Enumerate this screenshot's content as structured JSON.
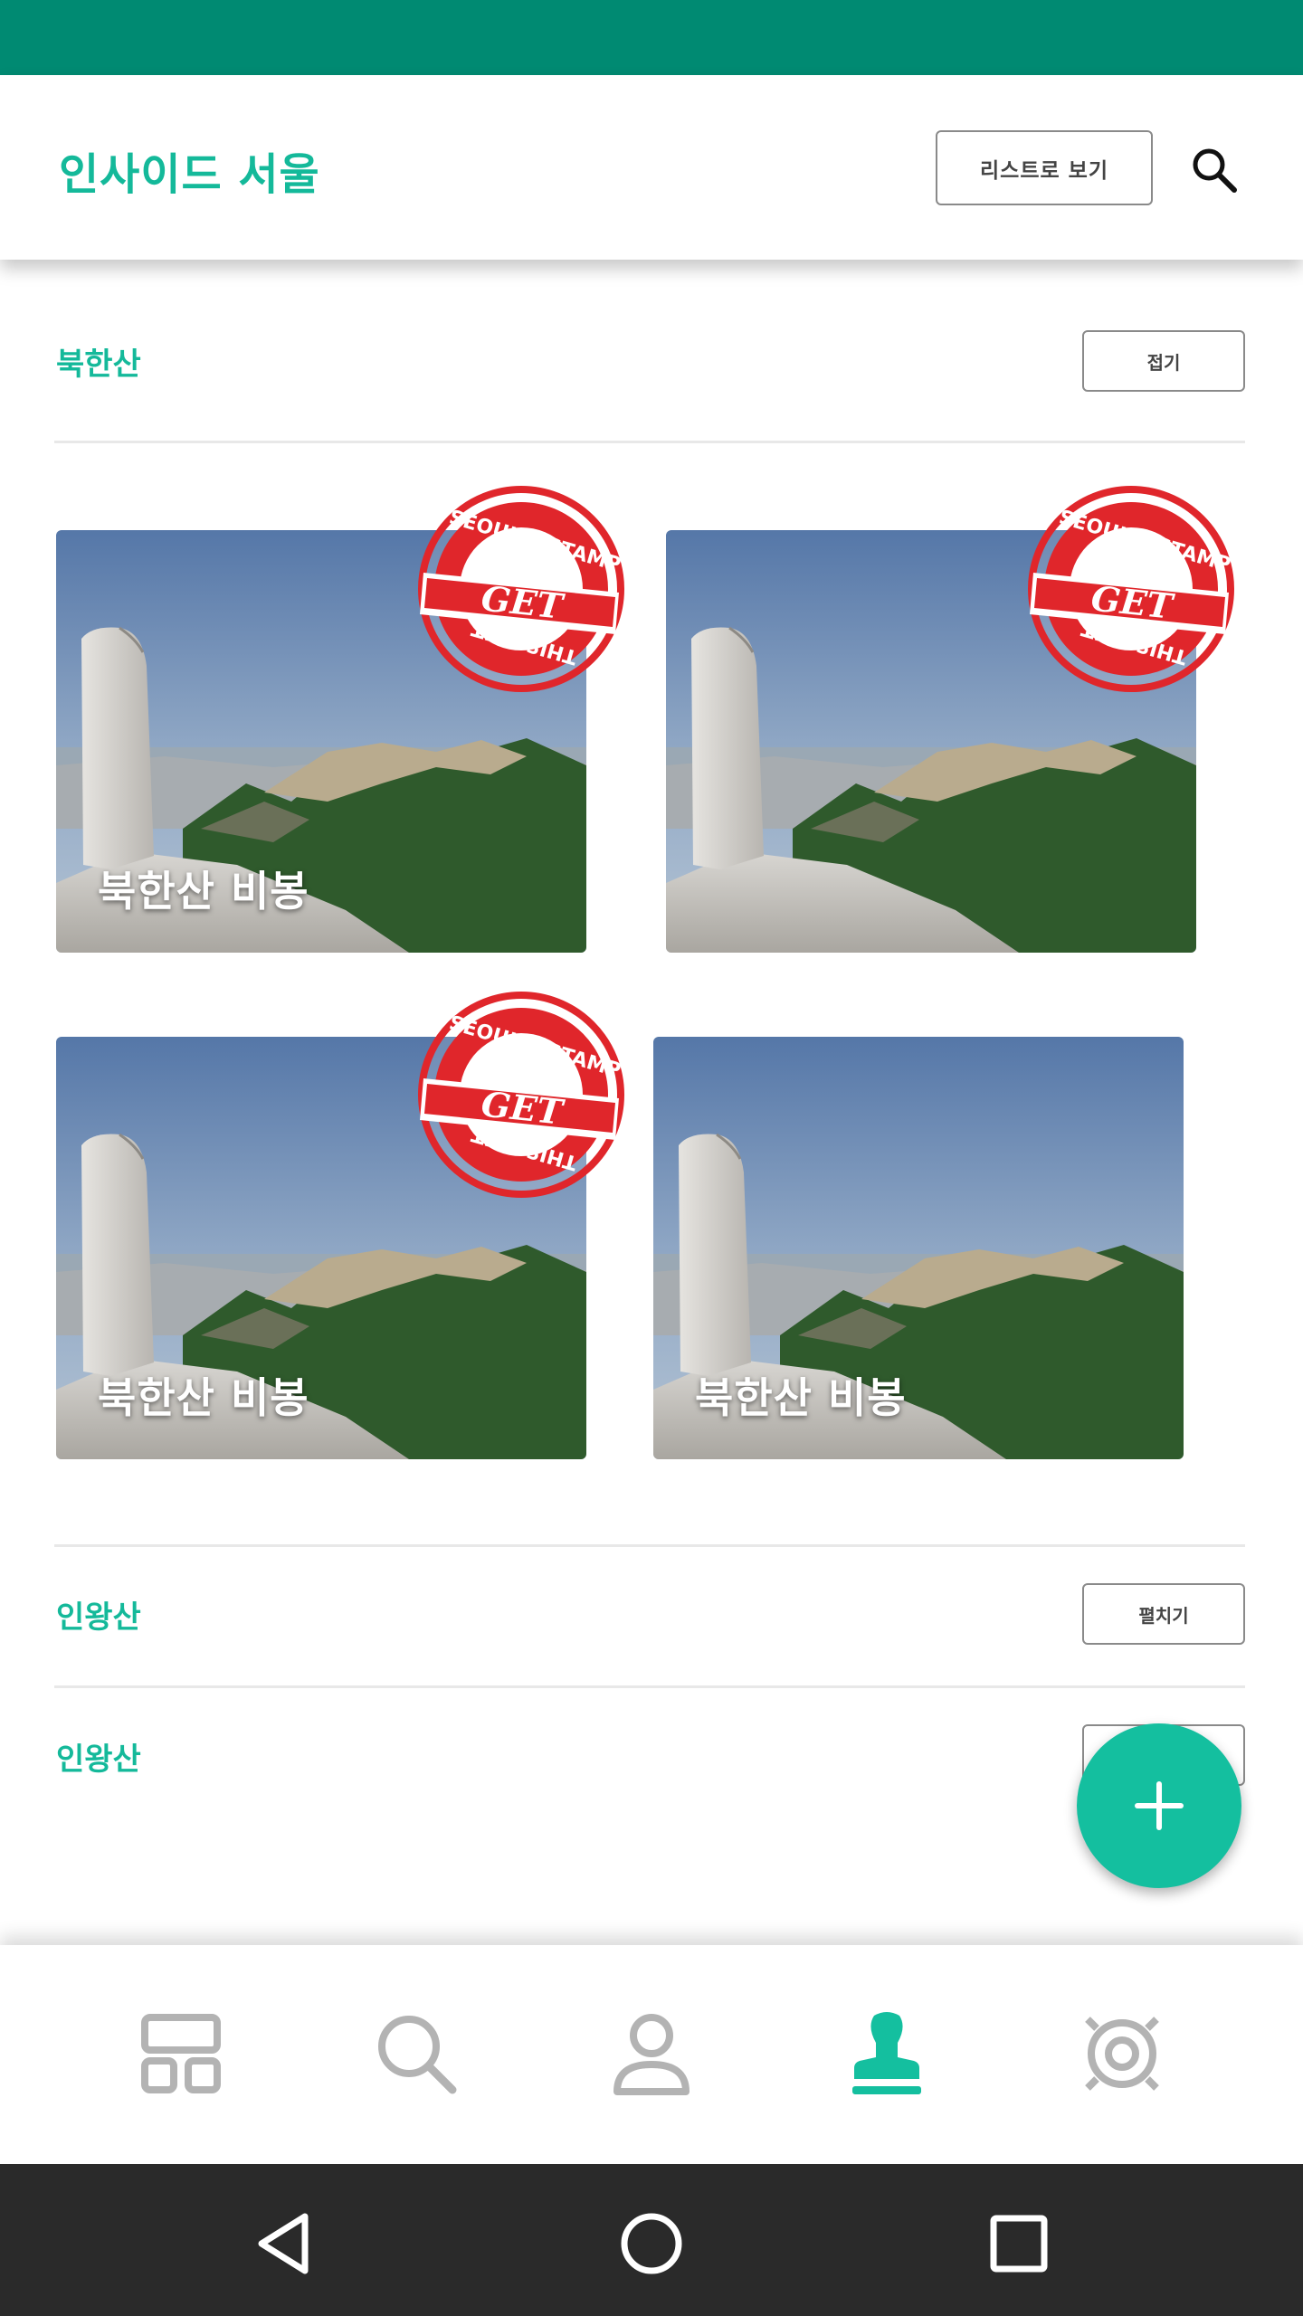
{
  "app": {
    "title": "인사이드 서울"
  },
  "header": {
    "list_view_label": "리스트로 보기",
    "search_icon": "search-icon"
  },
  "sections": [
    {
      "title": "북한산",
      "toggle_label": "접기",
      "cards": [
        {
          "label": "북한산 비봉",
          "stamped": true
        },
        {
          "label": "",
          "stamped": true
        },
        {
          "label": "북한산 비봉",
          "stamped": true
        },
        {
          "label": "북한산 비봉",
          "stamped": false
        }
      ]
    },
    {
      "title": "인왕산",
      "toggle_label": "펼치기"
    },
    {
      "title": "인왕산",
      "toggle_label": ""
    }
  ],
  "stamp": {
    "top_text": "SEOUL'S STAMP",
    "middle_text": "GET",
    "bottom_text": "THIS IS IT",
    "color": "#e0262b"
  },
  "fab": {
    "icon": "plus-icon"
  },
  "bottom_nav": {
    "items": [
      {
        "icon": "dashboard-icon",
        "active": false
      },
      {
        "icon": "search-icon",
        "active": false
      },
      {
        "icon": "person-icon",
        "active": false
      },
      {
        "icon": "stamp-icon",
        "active": true
      },
      {
        "icon": "settings-icon",
        "active": false
      }
    ],
    "active_color": "#14bf9f",
    "inactive_color": "#b3b3b3"
  },
  "colors": {
    "accent": "#14b99a",
    "status_bar": "#008a72",
    "system_nav": "#2a2a2a"
  }
}
